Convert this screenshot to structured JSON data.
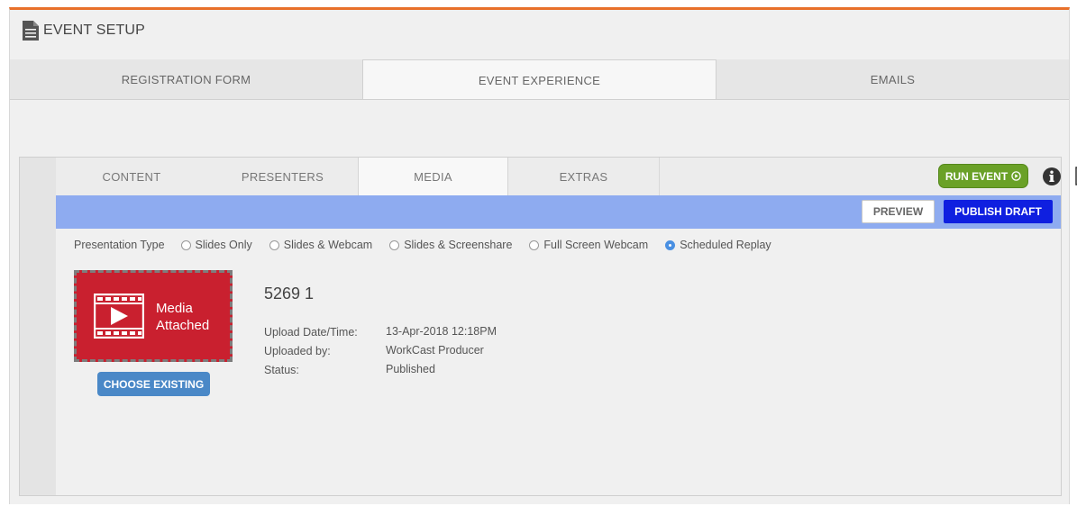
{
  "header": {
    "title": "EVENT SETUP",
    "icon": "document-icon"
  },
  "main_tabs": [
    {
      "label": "REGISTRATION FORM",
      "active": false
    },
    {
      "label": "EVENT EXPERIENCE",
      "active": true
    },
    {
      "label": "EMAILS",
      "active": false
    }
  ],
  "sub_tabs": [
    {
      "label": "CONTENT",
      "active": false
    },
    {
      "label": "PRESENTERS",
      "active": false
    },
    {
      "label": "MEDIA",
      "active": true
    },
    {
      "label": "EXTRAS",
      "active": false
    }
  ],
  "toolbar": {
    "run_event_label": "RUN EVENT",
    "preview_label": "PREVIEW",
    "publish_label": "PUBLISH DRAFT",
    "info_icon": "info-icon",
    "notes_icon": "notes-icon"
  },
  "presentation_type": {
    "label": "Presentation Type",
    "options": [
      "Slides Only",
      "Slides & Webcam",
      "Slides & Screenshare",
      "Full Screen Webcam",
      "Scheduled Replay"
    ],
    "selected": "Scheduled Replay"
  },
  "media": {
    "tile_line1": "Media",
    "tile_line2": "Attached",
    "choose_existing_label": "CHOOSE EXISTING",
    "name": "5269 1",
    "details": [
      {
        "label": "Upload Date/Time:",
        "value": "13-Apr-2018 12:18PM"
      },
      {
        "label": "Uploaded by:",
        "value": "WorkCast Producer"
      },
      {
        "label": "Status:",
        "value": "Published"
      }
    ]
  },
  "colors": {
    "accent_orange": "#e8702a",
    "run_event_green": "#6aa127",
    "publish_blue": "#0f1fe0",
    "bar_blue": "#8eabf0",
    "media_red": "#c9202f",
    "choose_blue": "#4a88c7",
    "radio_selected": "#4a90e2"
  }
}
